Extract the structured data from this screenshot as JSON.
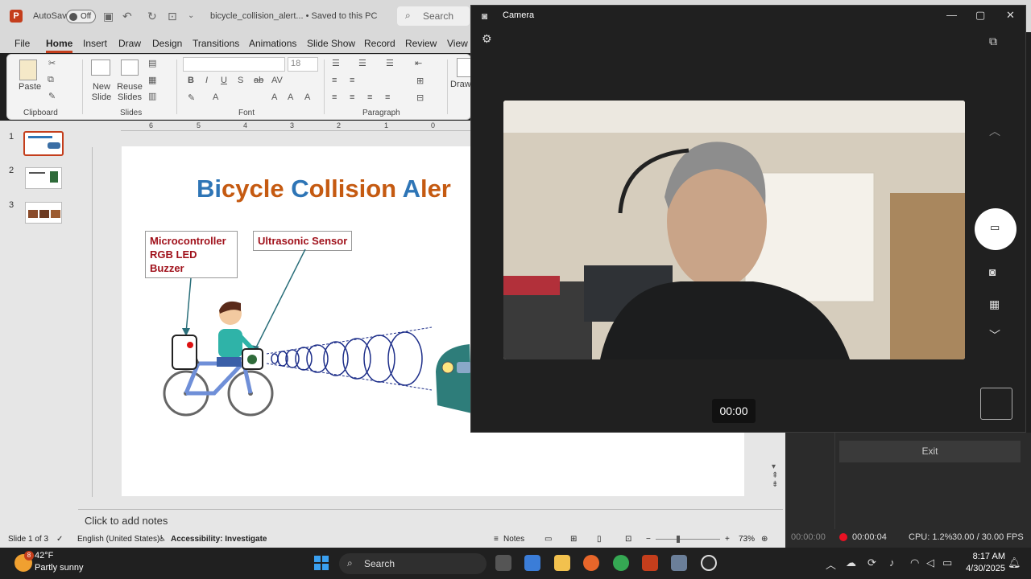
{
  "titlebar": {
    "app_logo": "P",
    "autosave_label": "AutoSave",
    "autosave_state": "Off",
    "document_name": "bicycle_collision_alert...",
    "save_status": "• Saved to this PC",
    "search_placeholder": "Search"
  },
  "tabs": [
    "File",
    "Home",
    "Insert",
    "Draw",
    "Design",
    "Transitions",
    "Animations",
    "Slide Show",
    "Record",
    "Review",
    "View"
  ],
  "active_tab": "Home",
  "ribbon": {
    "paste_label": "Paste",
    "new_slide_label": "New Slide",
    "reuse_slides_label": "Reuse Slides",
    "draw_label": "Draw",
    "font_size_value": "18",
    "groups": {
      "clipboard": "Clipboard",
      "slides": "Slides",
      "font": "Font",
      "paragraph": "Paragraph"
    }
  },
  "ruler_ticks": [
    "6",
    "5",
    "4",
    "3",
    "2",
    "1",
    "0"
  ],
  "thumbnails": [
    {
      "number": "1"
    },
    {
      "number": "2"
    },
    {
      "number": "3"
    }
  ],
  "slide": {
    "title_part1": "Bi",
    "title_part2": "cycle ",
    "title_part3": "C",
    "title_part4": "ollision ",
    "title_part5": "A",
    "title_part6": "ler",
    "callout_mcu_line1": "Microcontroller",
    "callout_mcu_line2": "RGB LED",
    "callout_mcu_line3": "Buzzer",
    "callout_sensor": "Ultrasonic Sensor"
  },
  "notes_placeholder": "Click to add notes",
  "status": {
    "slide_counter": "Slide 1 of 3",
    "language": "English (United States)",
    "accessibility": "Accessibility: Investigate",
    "notes_button": "Notes",
    "zoom_minus": "−",
    "zoom_plus": "+",
    "zoom": "73%"
  },
  "obs": {
    "exit_label": "Exit",
    "stream_time": "00:00:00",
    "record_time": "00:00:04",
    "cpu": "CPU: 1.2%",
    "fps": "30.00 / 30.00 FPS"
  },
  "camera": {
    "title": "Camera",
    "timer": "00:00",
    "icons": [
      "camera-icon",
      "settings-icon",
      "minimize-icon",
      "maximize-icon",
      "close-icon",
      "capture-settings-icon",
      "video-mode-icon",
      "photo-mode-icon",
      "qr-mode-icon",
      "chevron-down-icon",
      "chevron-up-icon"
    ]
  },
  "taskbar": {
    "weather_badge": "8",
    "weather_temp": "42°F",
    "weather_desc": "Partly sunny",
    "search_placeholder": "Search",
    "time": "8:17 AM",
    "date": "4/30/2025"
  },
  "colors": {
    "ppt_accent": "#c43e1c",
    "title_blue": "#2e75b6",
    "title_orange": "#c55a11",
    "callout_text": "#a0111b",
    "record_red": "#e81123"
  }
}
